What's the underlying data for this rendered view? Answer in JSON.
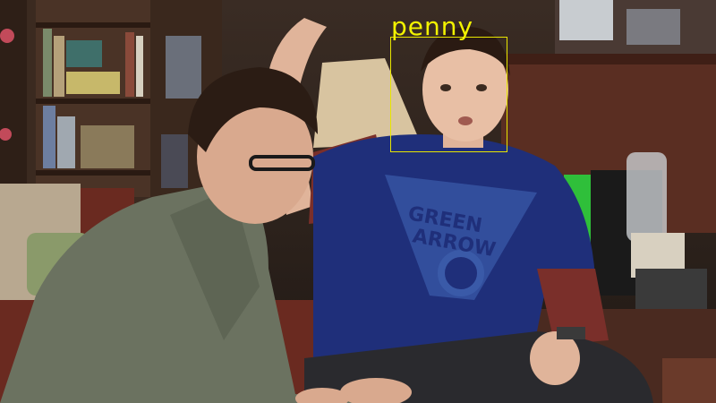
{
  "detection": {
    "label": "penny",
    "color": "#f2f200"
  },
  "shirt_print": {
    "line1": "GREEN",
    "line2": "ARROW"
  },
  "colors": {
    "left_shirt": "#6b7260",
    "right_shirt": "#1f2f7a",
    "undershirt": "#7a2f2a",
    "background": "#2b211b"
  }
}
